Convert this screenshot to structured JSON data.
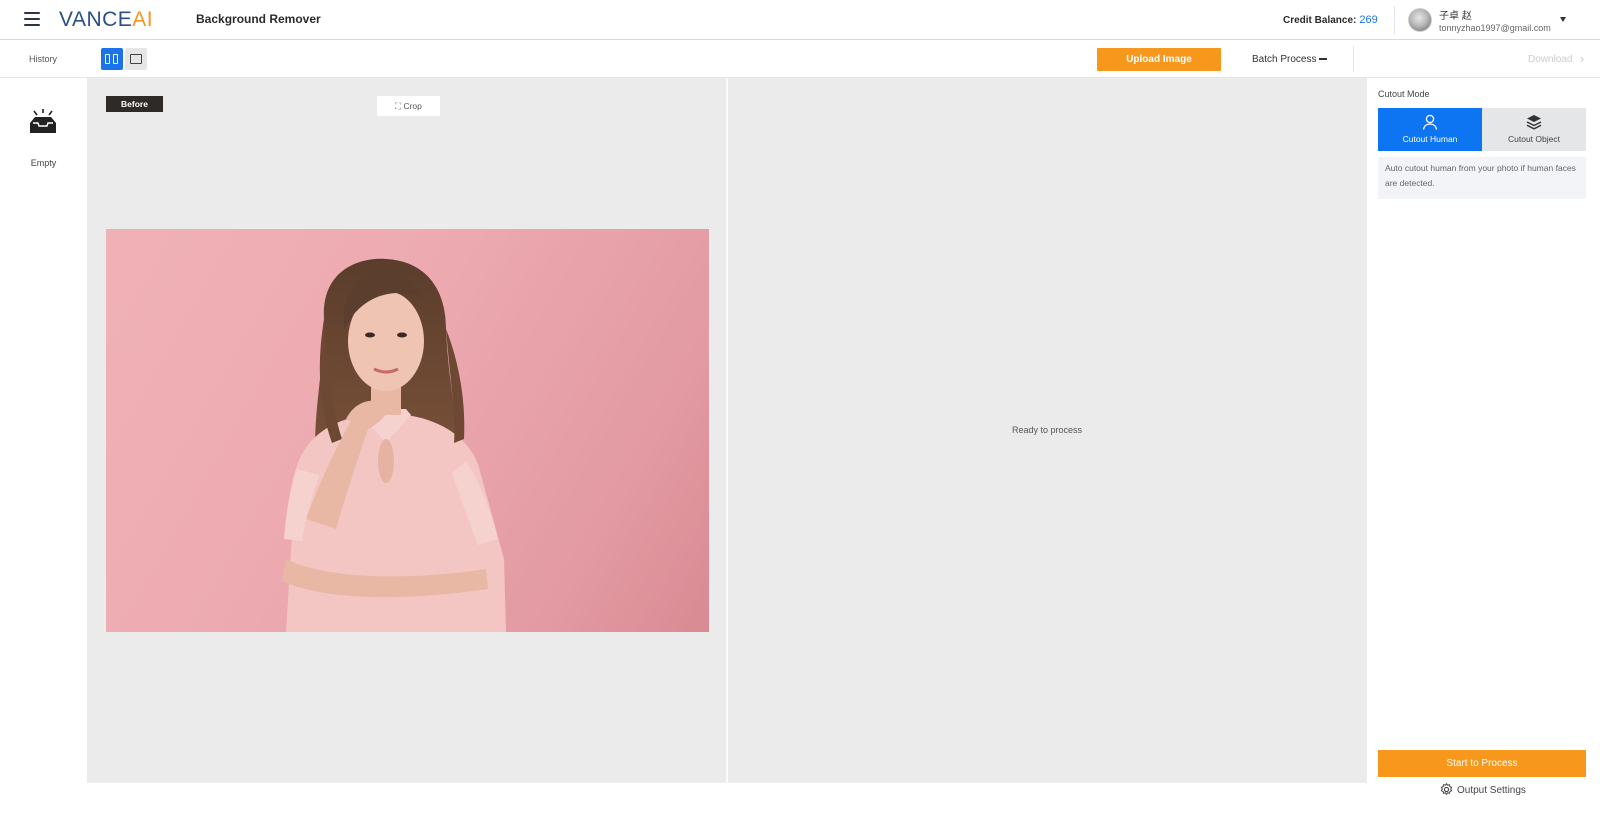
{
  "header": {
    "logo_primary": "VANCE",
    "logo_accent": "AI",
    "app_title": "Background Remover",
    "credit_label": "Credit Balance:",
    "credit_value": "269",
    "user_name": "子卓 赵",
    "user_email": "tonnyzhao1997@gmail.com"
  },
  "toolbar": {
    "history_label": "History",
    "upload_label": "Upload Image",
    "batch_label": "Batch Process",
    "download_label": "Download"
  },
  "history": {
    "empty_label": "Empty"
  },
  "canvas": {
    "before_tag": "Before",
    "crop_label": "Crop",
    "ready_text": "Ready to process"
  },
  "right_panel": {
    "cutout_mode_label": "Cutout Mode",
    "modes": [
      {
        "label": "Cutout Human",
        "icon": "person-icon",
        "selected": true
      },
      {
        "label": "Cutout Object",
        "icon": "layers-icon",
        "selected": false
      }
    ],
    "mode_description": "Auto cutout human from your photo if human faces are detected.",
    "start_label": "Start to Process",
    "output_settings_label": "Output Settings"
  },
  "colors": {
    "brand_blue": "#2c4e87",
    "brand_orange": "#f5961f",
    "accent_blue": "#0d74f2",
    "button_orange": "#f7981d"
  }
}
